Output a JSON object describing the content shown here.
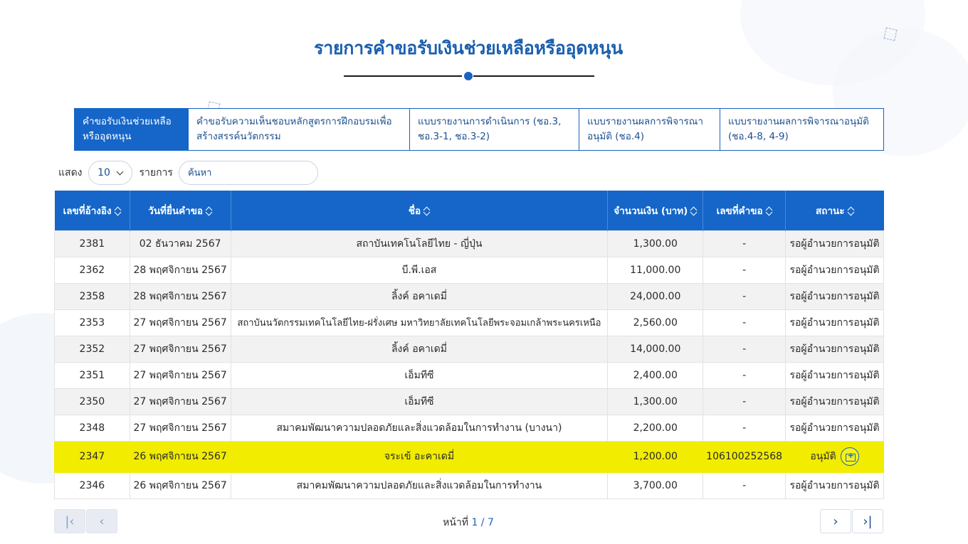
{
  "page": {
    "title": "รายการคำขอรับเงินช่วยเหลือหรืออุดหนุน"
  },
  "tabs": [
    {
      "label": "คำขอรับเงินช่วยเหลือหรืออุดหนุน",
      "active": true
    },
    {
      "label": "คำขอรับความเห็นชอบหลักสูตรการฝึกอบรมเพื่อสร้างสรรค์นวัตกรรม",
      "active": false
    },
    {
      "label": "แบบรายงานการดำเนินการ (ชอ.3, ชอ.3-1, ชอ.3-2)",
      "active": false
    },
    {
      "label": "แบบรายงานผลการพิจารณาอนุมัติ (ชอ.4)",
      "active": false
    },
    {
      "label": "แบบรายงานผลการพิจารณาอนุมัติ (ชอ.4-8, 4-9)",
      "active": false
    }
  ],
  "toolbar": {
    "show_label": "แสดง",
    "page_size": "10",
    "items_label": "รายการ",
    "search_placeholder": "ค้นหา"
  },
  "table": {
    "headers": [
      "เลขที่อ้างอิง",
      "วันที่ยื่นคำขอ",
      "ชื่อ",
      "จำนวนเงิน (บาท)",
      "เลขที่คำขอ",
      "สถานะ"
    ],
    "rows": [
      [
        "2381",
        "02 ธันวาคม 2567",
        "สถาบันเทคโนโลยีไทย - ญี่ปุ่น",
        "1,300.00",
        "-",
        "รอผู้อำนวยการอนุมัติ"
      ],
      [
        "2362",
        "28 พฤศจิกายน 2567",
        "บี.พี.เอส",
        "11,000.00",
        "-",
        "รอผู้อำนวยการอนุมัติ"
      ],
      [
        "2358",
        "28 พฤศจิกายน 2567",
        "ลิ้งค์ อคาเดมี่",
        "24,000.00",
        "-",
        "รอผู้อำนวยการอนุมัติ"
      ],
      [
        "2353",
        "27 พฤศจิกายน 2567",
        "สถาบันนวัตกรรมเทคโนโลยีไทย-ฝรั่งเศษ มหาวิทยาลัยเทคโนโลยีพระจอมเกล้าพระนครเหนือ",
        "2,560.00",
        "-",
        "รอผู้อำนวยการอนุมัติ"
      ],
      [
        "2352",
        "27 พฤศจิกายน 2567",
        "ลิ้งค์ อคาเดมี่",
        "14,000.00",
        "-",
        "รอผู้อำนวยการอนุมัติ"
      ],
      [
        "2351",
        "27 พฤศจิกายน 2567",
        "เอ็มทีซี",
        "2,400.00",
        "-",
        "รอผู้อำนวยการอนุมัติ"
      ],
      [
        "2350",
        "27 พฤศจิกายน 2567",
        "เอ็มทีซี",
        "1,300.00",
        "-",
        "รอผู้อำนวยการอนุมัติ"
      ],
      [
        "2348",
        "27 พฤศจิกายน 2567",
        "สมาคมพัฒนาความปลอดภัยและสิ่งแวดล้อมในการทำงาน (บางนา)",
        "2,200.00",
        "-",
        "รอผู้อำนวยการอนุมัติ"
      ],
      [
        "2347",
        "26 พฤศจิกายน 2567",
        "จระเข้ อะคาเดมี่",
        "1,200.00",
        "106100252568",
        "อนุมัติ"
      ],
      [
        "2346",
        "26 พฤศจิกายน 2567",
        "สมาคมพัฒนาความปลอดภัยและสิ่งแวดล้อมในการทำงาน",
        "3,700.00",
        "-",
        "รอผู้อำนวยการอนุมัติ"
      ]
    ],
    "highlighted_row": 8
  },
  "pagination": {
    "page_label": "หน้าที่",
    "current": "1 / 7",
    "first_icon": "first-page-icon",
    "prev_icon": "prev-page-icon",
    "next_icon": "next-page-icon",
    "last_icon": "last-page-icon"
  },
  "colors": {
    "primary": "#1566c8",
    "highlight": "#f1ec00",
    "title": "#1b5fae"
  }
}
